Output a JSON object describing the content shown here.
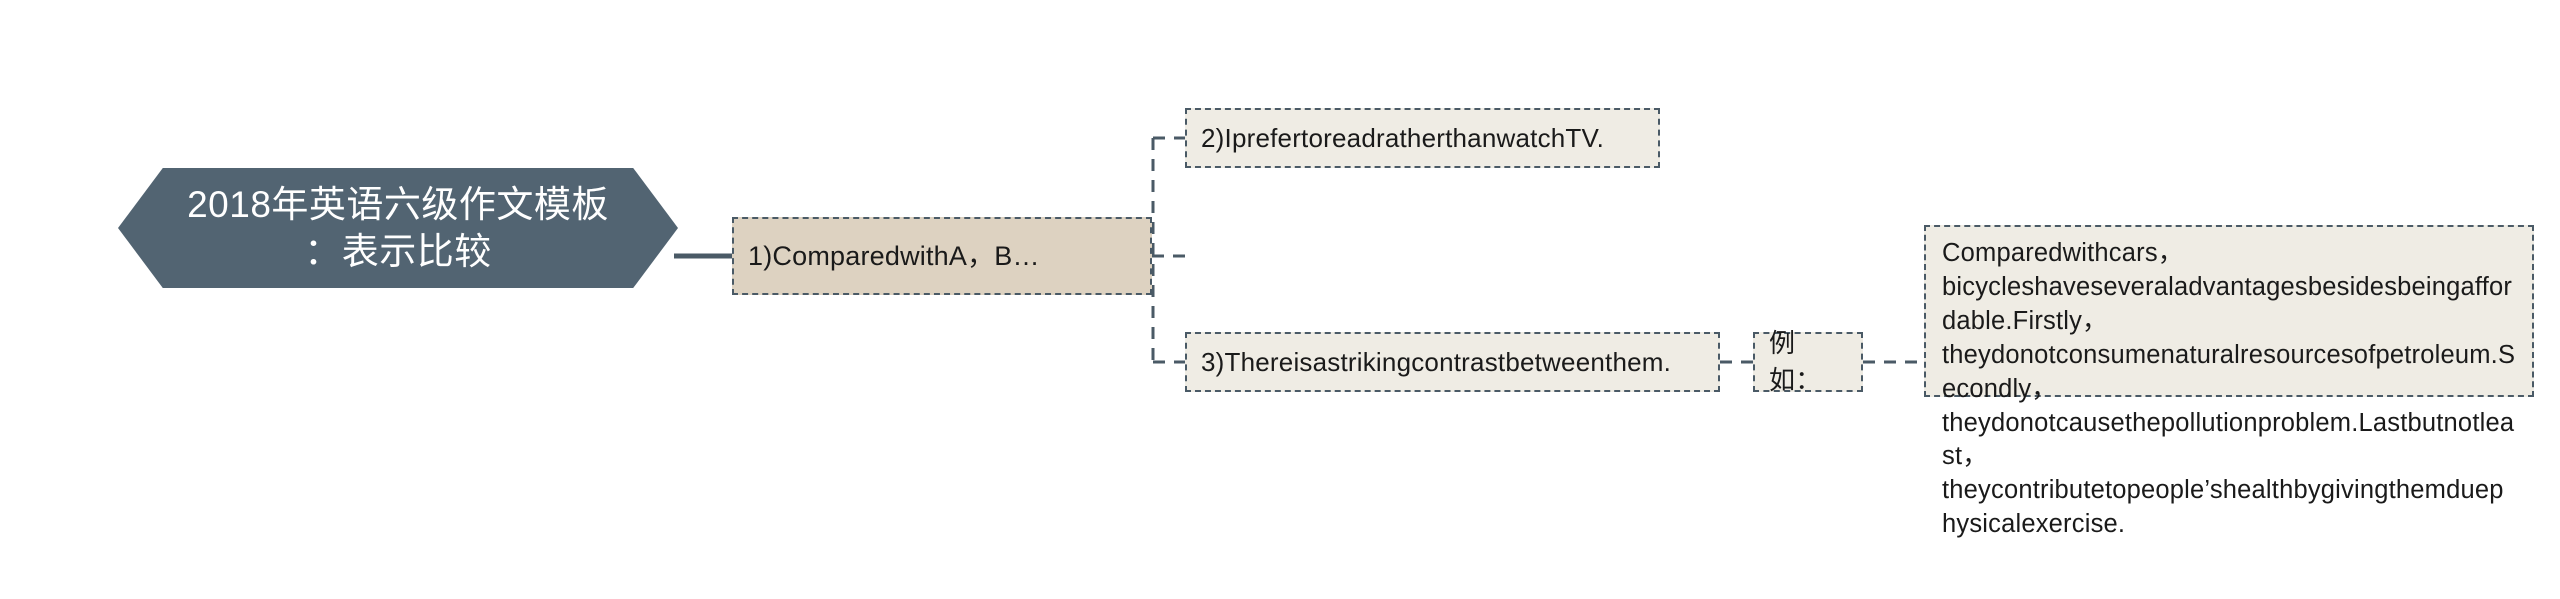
{
  "diagram": {
    "type": "mind-map",
    "background_color": "#ffffff",
    "root": {
      "id": "root",
      "label": "2018年英语六级作文模板\n：表示比较",
      "shape": "hexagon",
      "fill_color": "#526472",
      "text_color": "#ffffff"
    },
    "nodes": [
      {
        "id": "node-compared",
        "label": "1)ComparedwithA，B…",
        "shape": "dashed-rectangle",
        "fill_color": "#ddd2c1",
        "border_color": "#4a5a66",
        "text_color": "#1a1a1a",
        "level": 1
      },
      {
        "id": "node-prefer",
        "label": "2)IprefertoreadratherthanwatchTV.",
        "shape": "dashed-rectangle",
        "fill_color": "#efece4",
        "border_color": "#4a5a66",
        "text_color": "#1a1a1a",
        "level": 2
      },
      {
        "id": "node-contrast",
        "label": "3)Thereisastrikingcontrastbetweenthem.",
        "shape": "dashed-rectangle",
        "fill_color": "#efece4",
        "border_color": "#4a5a66",
        "text_color": "#1a1a1a",
        "level": 2
      },
      {
        "id": "node-liru",
        "label": "例如：",
        "shape": "dashed-rectangle",
        "fill_color": "#efece4",
        "border_color": "#4a5a66",
        "text_color": "#1a1a1a",
        "level": 3
      },
      {
        "id": "node-example",
        "label": "Comparedwithcars，bicycleshaveseveraladvantagesbesidesbeingaffordable.Firstly，theydonotconsumenaturalresourcesofpetroleum.Secondly，theydonotcausethepollutionproblem.Lastbutnotleast，theycontributetopeople’shealthbygivingthemduephysicalexercise.",
        "shape": "dashed-rectangle",
        "fill_color": "#efece4",
        "border_color": "#4a5a66",
        "text_color": "#1a1a1a",
        "level": 4
      }
    ],
    "edges": [
      {
        "from": "root",
        "to": "node-compared",
        "style": "solid",
        "color": "#4a5a66"
      },
      {
        "from": "node-compared",
        "to": "node-prefer",
        "style": "dashed",
        "color": "#4a5a66"
      },
      {
        "from": "node-compared",
        "to": "node-contrast",
        "style": "dashed",
        "color": "#4a5a66"
      },
      {
        "from": "node-contrast",
        "to": "node-liru",
        "style": "dashed",
        "color": "#4a5a66"
      },
      {
        "from": "node-liru",
        "to": "node-example",
        "style": "dashed",
        "color": "#4a5a66"
      }
    ]
  }
}
